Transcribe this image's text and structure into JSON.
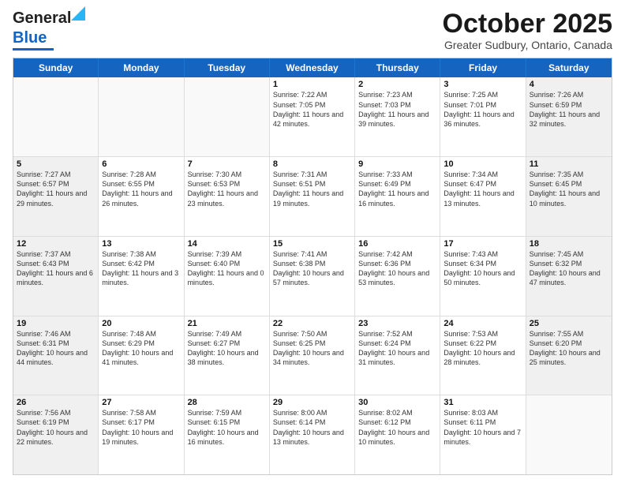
{
  "logo": {
    "line1": "General",
    "line2": "Blue"
  },
  "title": "October 2025",
  "location": "Greater Sudbury, Ontario, Canada",
  "weekdays": [
    "Sunday",
    "Monday",
    "Tuesday",
    "Wednesday",
    "Thursday",
    "Friday",
    "Saturday"
  ],
  "rows": [
    [
      {
        "day": "",
        "text": "",
        "empty": true
      },
      {
        "day": "",
        "text": "",
        "empty": true
      },
      {
        "day": "",
        "text": "",
        "empty": true
      },
      {
        "day": "1",
        "text": "Sunrise: 7:22 AM\nSunset: 7:05 PM\nDaylight: 11 hours and 42 minutes."
      },
      {
        "day": "2",
        "text": "Sunrise: 7:23 AM\nSunset: 7:03 PM\nDaylight: 11 hours and 39 minutes."
      },
      {
        "day": "3",
        "text": "Sunrise: 7:25 AM\nSunset: 7:01 PM\nDaylight: 11 hours and 36 minutes."
      },
      {
        "day": "4",
        "text": "Sunrise: 7:26 AM\nSunset: 6:59 PM\nDaylight: 11 hours and 32 minutes.",
        "shaded": true
      }
    ],
    [
      {
        "day": "5",
        "text": "Sunrise: 7:27 AM\nSunset: 6:57 PM\nDaylight: 11 hours and 29 minutes.",
        "shaded": true
      },
      {
        "day": "6",
        "text": "Sunrise: 7:28 AM\nSunset: 6:55 PM\nDaylight: 11 hours and 26 minutes."
      },
      {
        "day": "7",
        "text": "Sunrise: 7:30 AM\nSunset: 6:53 PM\nDaylight: 11 hours and 23 minutes."
      },
      {
        "day": "8",
        "text": "Sunrise: 7:31 AM\nSunset: 6:51 PM\nDaylight: 11 hours and 19 minutes."
      },
      {
        "day": "9",
        "text": "Sunrise: 7:33 AM\nSunset: 6:49 PM\nDaylight: 11 hours and 16 minutes."
      },
      {
        "day": "10",
        "text": "Sunrise: 7:34 AM\nSunset: 6:47 PM\nDaylight: 11 hours and 13 minutes."
      },
      {
        "day": "11",
        "text": "Sunrise: 7:35 AM\nSunset: 6:45 PM\nDaylight: 11 hours and 10 minutes.",
        "shaded": true
      }
    ],
    [
      {
        "day": "12",
        "text": "Sunrise: 7:37 AM\nSunset: 6:43 PM\nDaylight: 11 hours and 6 minutes.",
        "shaded": true
      },
      {
        "day": "13",
        "text": "Sunrise: 7:38 AM\nSunset: 6:42 PM\nDaylight: 11 hours and 3 minutes."
      },
      {
        "day": "14",
        "text": "Sunrise: 7:39 AM\nSunset: 6:40 PM\nDaylight: 11 hours and 0 minutes."
      },
      {
        "day": "15",
        "text": "Sunrise: 7:41 AM\nSunset: 6:38 PM\nDaylight: 10 hours and 57 minutes."
      },
      {
        "day": "16",
        "text": "Sunrise: 7:42 AM\nSunset: 6:36 PM\nDaylight: 10 hours and 53 minutes."
      },
      {
        "day": "17",
        "text": "Sunrise: 7:43 AM\nSunset: 6:34 PM\nDaylight: 10 hours and 50 minutes."
      },
      {
        "day": "18",
        "text": "Sunrise: 7:45 AM\nSunset: 6:32 PM\nDaylight: 10 hours and 47 minutes.",
        "shaded": true
      }
    ],
    [
      {
        "day": "19",
        "text": "Sunrise: 7:46 AM\nSunset: 6:31 PM\nDaylight: 10 hours and 44 minutes.",
        "shaded": true
      },
      {
        "day": "20",
        "text": "Sunrise: 7:48 AM\nSunset: 6:29 PM\nDaylight: 10 hours and 41 minutes."
      },
      {
        "day": "21",
        "text": "Sunrise: 7:49 AM\nSunset: 6:27 PM\nDaylight: 10 hours and 38 minutes."
      },
      {
        "day": "22",
        "text": "Sunrise: 7:50 AM\nSunset: 6:25 PM\nDaylight: 10 hours and 34 minutes."
      },
      {
        "day": "23",
        "text": "Sunrise: 7:52 AM\nSunset: 6:24 PM\nDaylight: 10 hours and 31 minutes."
      },
      {
        "day": "24",
        "text": "Sunrise: 7:53 AM\nSunset: 6:22 PM\nDaylight: 10 hours and 28 minutes."
      },
      {
        "day": "25",
        "text": "Sunrise: 7:55 AM\nSunset: 6:20 PM\nDaylight: 10 hours and 25 minutes.",
        "shaded": true
      }
    ],
    [
      {
        "day": "26",
        "text": "Sunrise: 7:56 AM\nSunset: 6:19 PM\nDaylight: 10 hours and 22 minutes.",
        "shaded": true
      },
      {
        "day": "27",
        "text": "Sunrise: 7:58 AM\nSunset: 6:17 PM\nDaylight: 10 hours and 19 minutes."
      },
      {
        "day": "28",
        "text": "Sunrise: 7:59 AM\nSunset: 6:15 PM\nDaylight: 10 hours and 16 minutes."
      },
      {
        "day": "29",
        "text": "Sunrise: 8:00 AM\nSunset: 6:14 PM\nDaylight: 10 hours and 13 minutes."
      },
      {
        "day": "30",
        "text": "Sunrise: 8:02 AM\nSunset: 6:12 PM\nDaylight: 10 hours and 10 minutes."
      },
      {
        "day": "31",
        "text": "Sunrise: 8:03 AM\nSunset: 6:11 PM\nDaylight: 10 hours and 7 minutes."
      },
      {
        "day": "",
        "text": "",
        "empty": true,
        "shaded": true
      }
    ]
  ]
}
